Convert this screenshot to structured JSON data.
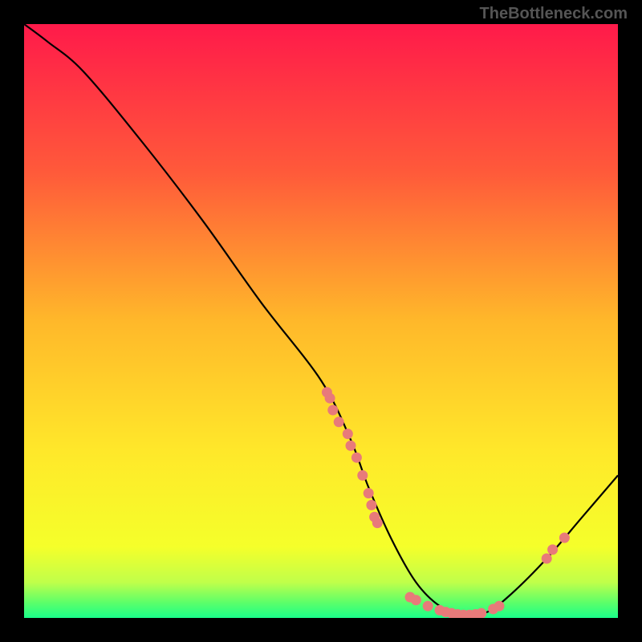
{
  "watermark": "TheBottleneck.com",
  "chart_data": {
    "type": "line",
    "title": "",
    "xlabel": "",
    "ylabel": "",
    "xlim": [
      0,
      100
    ],
    "ylim": [
      0,
      100
    ],
    "curve": {
      "x": [
        0,
        4,
        10,
        20,
        30,
        40,
        50,
        55,
        58,
        62,
        66,
        70,
        74,
        78,
        82,
        88,
        94,
        100
      ],
      "y": [
        100,
        97,
        92,
        80,
        67,
        53,
        40,
        30,
        22,
        13,
        6,
        2,
        0.5,
        1,
        4,
        10,
        17,
        24
      ]
    },
    "markers": [
      {
        "x": 51,
        "y": 38
      },
      {
        "x": 51.5,
        "y": 37
      },
      {
        "x": 52,
        "y": 35
      },
      {
        "x": 53,
        "y": 33
      },
      {
        "x": 54.5,
        "y": 31
      },
      {
        "x": 55,
        "y": 29
      },
      {
        "x": 56,
        "y": 27
      },
      {
        "x": 57,
        "y": 24
      },
      {
        "x": 58,
        "y": 21
      },
      {
        "x": 58.5,
        "y": 19
      },
      {
        "x": 59,
        "y": 17
      },
      {
        "x": 59.5,
        "y": 16
      },
      {
        "x": 65,
        "y": 3.5
      },
      {
        "x": 66,
        "y": 3
      },
      {
        "x": 68,
        "y": 2
      },
      {
        "x": 70,
        "y": 1.3
      },
      {
        "x": 71,
        "y": 1
      },
      {
        "x": 72,
        "y": 0.8
      },
      {
        "x": 73,
        "y": 0.6
      },
      {
        "x": 74,
        "y": 0.5
      },
      {
        "x": 75,
        "y": 0.5
      },
      {
        "x": 76,
        "y": 0.6
      },
      {
        "x": 77,
        "y": 0.8
      },
      {
        "x": 79,
        "y": 1.5
      },
      {
        "x": 80,
        "y": 2
      },
      {
        "x": 88,
        "y": 10
      },
      {
        "x": 89,
        "y": 11.5
      },
      {
        "x": 91,
        "y": 13.5
      }
    ],
    "gradient_stops": [
      {
        "offset": 0,
        "color": "#ff1a4a"
      },
      {
        "offset": 0.25,
        "color": "#ff5a3a"
      },
      {
        "offset": 0.5,
        "color": "#ffb82a"
      },
      {
        "offset": 0.72,
        "color": "#ffe82a"
      },
      {
        "offset": 0.88,
        "color": "#f5ff2a"
      },
      {
        "offset": 0.94,
        "color": "#c0ff4a"
      },
      {
        "offset": 0.975,
        "color": "#5aff6a"
      },
      {
        "offset": 1,
        "color": "#1aff8a"
      }
    ],
    "marker_color": "#e87a7a"
  }
}
